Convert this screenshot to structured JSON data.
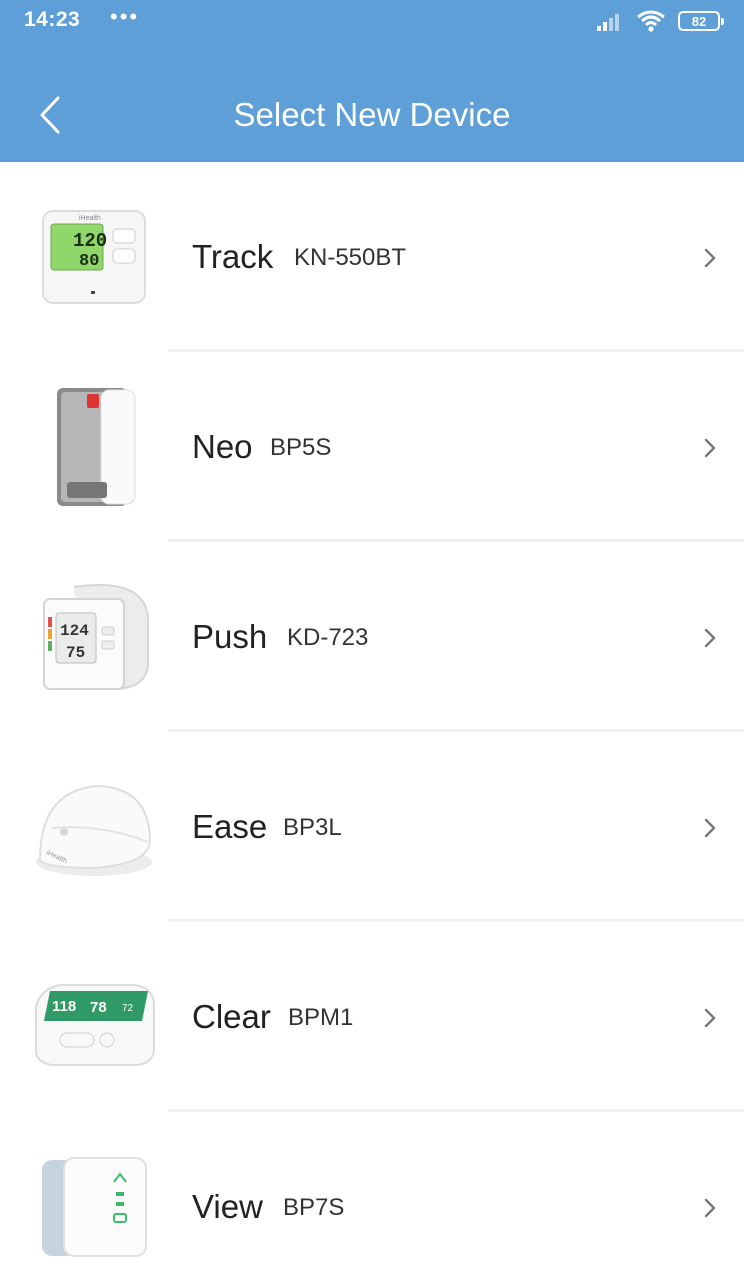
{
  "status_bar": {
    "time": "14:23",
    "dots": "•••",
    "battery": "82"
  },
  "header": {
    "title": "Select New Device"
  },
  "devices": [
    {
      "name": "Track",
      "model": "KN-550BT",
      "screen_top": "120",
      "screen_bottom": "80",
      "brand": "iHealth"
    },
    {
      "name": "Neo",
      "model": "BP5S"
    },
    {
      "name": "Push",
      "model": "KD-723",
      "screen_top": "124",
      "screen_bottom": "75"
    },
    {
      "name": "Ease",
      "model": "BP3L",
      "brand": "iHealth"
    },
    {
      "name": "Clear",
      "model": "BPM1",
      "screen_a": "118",
      "screen_b": "78",
      "screen_c": "72"
    },
    {
      "name": "View",
      "model": "BP7S"
    }
  ],
  "colors": {
    "header": "#5f9fd8",
    "divider": "#f1f1f1",
    "lcd_green": "#8fd66b",
    "clear_green": "#2f9a66"
  },
  "icons": {
    "back": "chevron-left-icon",
    "row_arrow": "chevron-right-icon",
    "signal": "signal-icon",
    "wifi": "wifi-icon",
    "battery": "battery-icon"
  }
}
